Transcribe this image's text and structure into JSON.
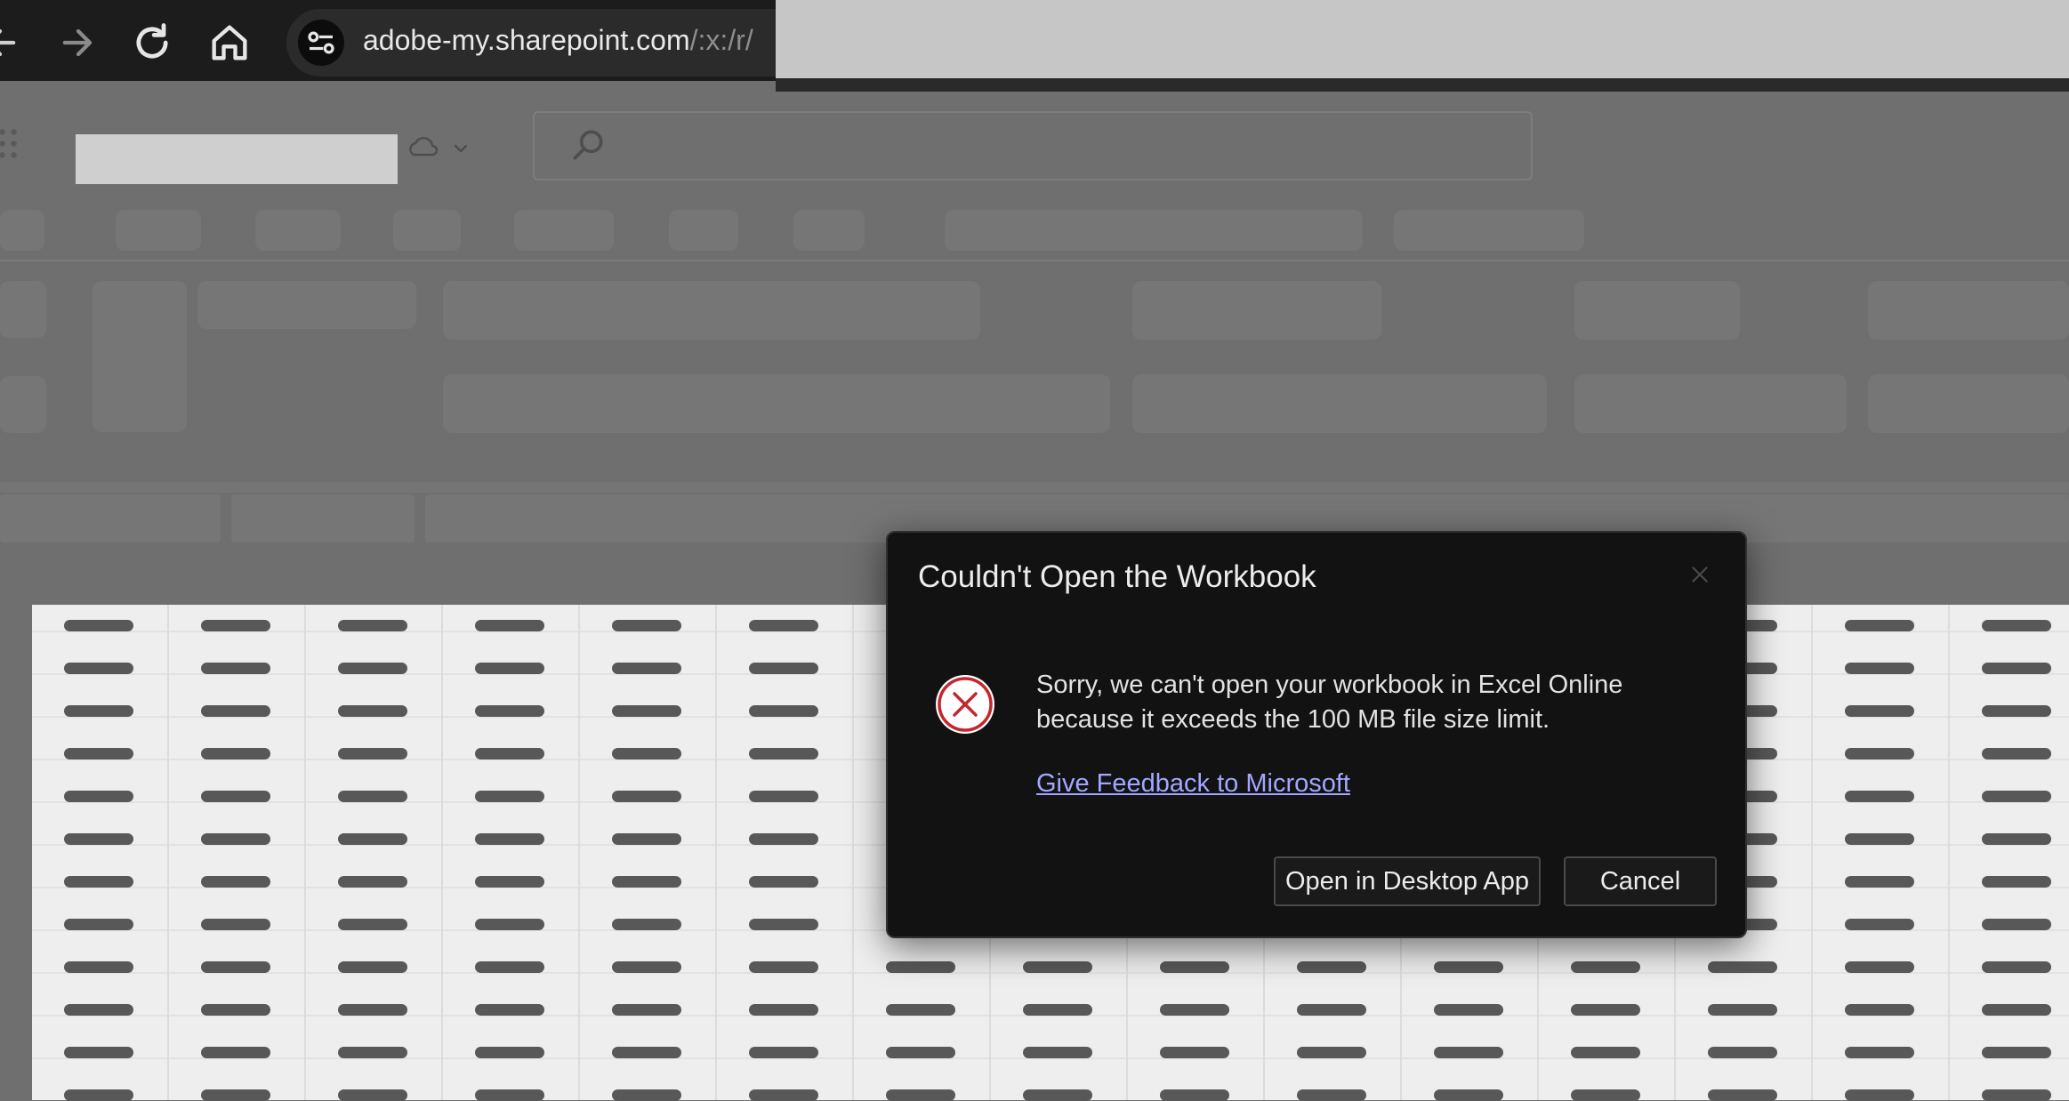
{
  "browser": {
    "url_host": "adobe-my.sharepoint.com",
    "url_path": "/:x:/r/",
    "icons": [
      "back-icon",
      "forward-icon",
      "reload-icon",
      "home-icon",
      "site-info-icon"
    ]
  },
  "app": {
    "icons": [
      "app-launcher-icon",
      "cloud-icon",
      "chevron-down-icon",
      "search-icon"
    ]
  },
  "dialog": {
    "title": "Couldn't Open the Workbook",
    "message": "Sorry, we can't open your workbook in Excel Online because it exceeds the 100 MB file size limit.",
    "feedback_link": "Give Feedback to Microsoft",
    "open_desktop_label": "Open in Desktop App",
    "cancel_label": "Cancel",
    "error_color": "#c4262e",
    "link_color": "#a2a6ff"
  }
}
